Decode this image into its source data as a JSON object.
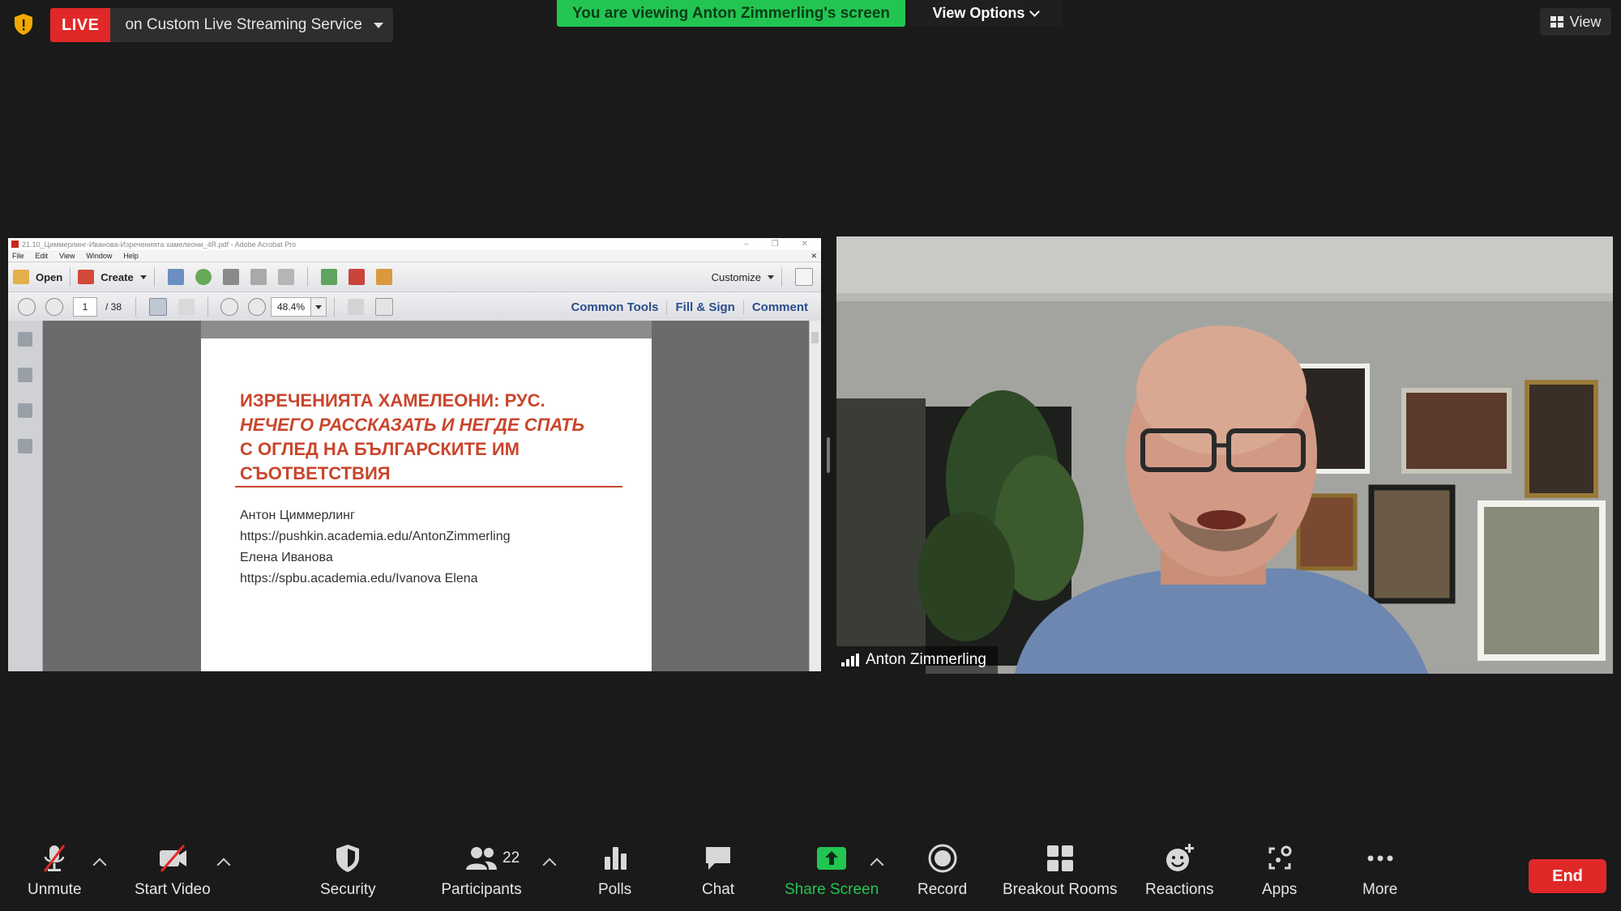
{
  "top_bar": {
    "live_badge": "LIVE",
    "live_service": "on Custom Live Streaming Service",
    "viewing_banner": "You are viewing Anton Zimmerling's screen",
    "view_options": "View Options",
    "view_button": "View"
  },
  "acrobat": {
    "title_bar": "21.10_Циммерлинг-Иванова-Изреченията хамелеони_4R.pdf - Adobe Acrobat Pro",
    "menu": [
      "File",
      "Edit",
      "View",
      "Window",
      "Help"
    ],
    "toolbar": {
      "open": "Open",
      "create": "Create",
      "customize": "Customize"
    },
    "nav": {
      "page_current": "1",
      "page_total": "/ 38",
      "zoom": "48.4%"
    },
    "panels": [
      "Common Tools",
      "Fill & Sign",
      "Comment"
    ]
  },
  "pdf": {
    "title_line1": "ИЗРЕЧЕНИЯТА ХАМЕЛЕОНИ: РУС.",
    "title_line2": "НЕЧЕГО РАССКАЗАТЬ И НЕГДЕ СПАТЬ",
    "title_line3": "С ОГЛЕД НА БЪЛГАРСКИТЕ ИМ",
    "title_line4": "СЪОТВЕТСТВИЯ",
    "author1": "Антон Циммерлинг",
    "author1_url": "https://pushkin.academia.edu/AntonZimmerling",
    "author2": "Елена Иванова",
    "author2_url": "https://spbu.academia.edu/Ivanova Elena"
  },
  "participant": {
    "name": "Anton Zimmerling"
  },
  "controls": {
    "unmute": "Unmute",
    "start_video": "Start Video",
    "security": "Security",
    "participants": "Participants",
    "participants_count": "22",
    "polls": "Polls",
    "chat": "Chat",
    "share_screen": "Share Screen",
    "record": "Record",
    "breakout_rooms": "Breakout Rooms",
    "reactions": "Reactions",
    "apps": "Apps",
    "more": "More",
    "end": "End"
  },
  "colors": {
    "live_red": "#e02828",
    "banner_green": "#23c552",
    "share_green": "#23c552",
    "pdf_title": "#c9462d"
  }
}
